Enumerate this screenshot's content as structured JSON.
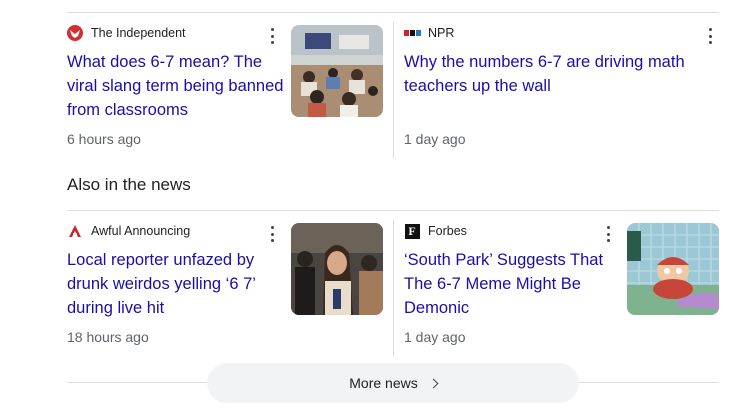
{
  "top_row": [
    {
      "source": "The Independent",
      "headline": "What does 6-7 mean? The viral slang term being banned from classrooms",
      "time": "6 hours ago",
      "logo_icon": "independent-eagle-logo"
    },
    {
      "source": "NPR",
      "headline": "Why the numbers 6-7 are driving math teachers up the wall",
      "time": "1 day ago",
      "logo_icon": "npr-logo"
    }
  ],
  "section": {
    "title": "Also in the news"
  },
  "bottom_row": [
    {
      "source": "Awful Announcing",
      "headline": "Local reporter unfazed by drunk weirdos yelling ‘6 7’ during live hit",
      "time": "18 hours ago",
      "logo_icon": "awful-announcing-logo"
    },
    {
      "source": "Forbes",
      "headline": "‘South Park’ Suggests That The 6-7 Meme Might Be Demonic",
      "time": "1 day ago",
      "logo_icon": "forbes-logo",
      "logo_letter": "F"
    }
  ],
  "more_button": {
    "label": "More news",
    "icon": "chevron-right-icon"
  },
  "colors": {
    "link": "#1a0dab",
    "meta": "#5f6368",
    "divider": "#dadce0",
    "button_bg": "#f1f3f4"
  }
}
